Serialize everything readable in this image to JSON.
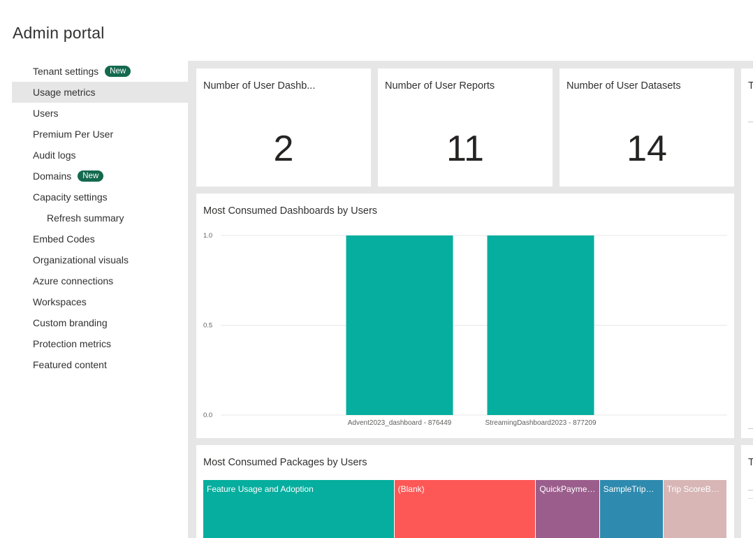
{
  "page": {
    "title": "Admin portal"
  },
  "sidebar": {
    "items": [
      {
        "label": "Tenant settings",
        "badge": "New"
      },
      {
        "label": "Usage metrics",
        "active": true
      },
      {
        "label": "Users"
      },
      {
        "label": "Premium Per User"
      },
      {
        "label": "Audit logs"
      },
      {
        "label": "Domains",
        "badge": "New"
      },
      {
        "label": "Capacity settings"
      },
      {
        "label": "Refresh summary",
        "sub": true
      },
      {
        "label": "Embed Codes"
      },
      {
        "label": "Organizational visuals"
      },
      {
        "label": "Azure connections"
      },
      {
        "label": "Workspaces"
      },
      {
        "label": "Custom branding"
      },
      {
        "label": "Protection metrics"
      },
      {
        "label": "Featured content"
      }
    ]
  },
  "cards": [
    {
      "title": "Number of User Dashb...",
      "value": "2"
    },
    {
      "title": "Number of User Reports",
      "value": "11"
    },
    {
      "title": "Number of User Datasets",
      "value": "14"
    }
  ],
  "right_tiles": [
    {
      "title": "T"
    },
    {
      "title": "T"
    }
  ],
  "colors": {
    "accent_badge": "#14694e",
    "bar": "#05ae9e",
    "treemap": [
      "#05ae9e",
      "#fd5756",
      "#9b5e8c",
      "#2e8aae",
      "#d8b6b6"
    ]
  },
  "chart_data": [
    {
      "type": "bar",
      "title": "Most Consumed Dashboards by Users",
      "categories": [
        "Advent2023_dashboard - 876449",
        "StreamingDashboard2023 - 877209"
      ],
      "values": [
        1,
        1
      ],
      "yticks": [
        "0.0",
        "0.5",
        "1.0"
      ],
      "ylim": [
        0,
        1
      ],
      "xlabel": "",
      "ylabel": "",
      "grid": true
    },
    {
      "type": "treemap",
      "title": "Most Consumed Packages by Users",
      "categories": [
        "Feature Usage and Adoption",
        "(Blank)",
        "QuickPaymet...",
        "SampleTripRe...",
        "Trip ScoreBoa..."
      ],
      "values": [
        27,
        20,
        9,
        9,
        9
      ]
    }
  ]
}
